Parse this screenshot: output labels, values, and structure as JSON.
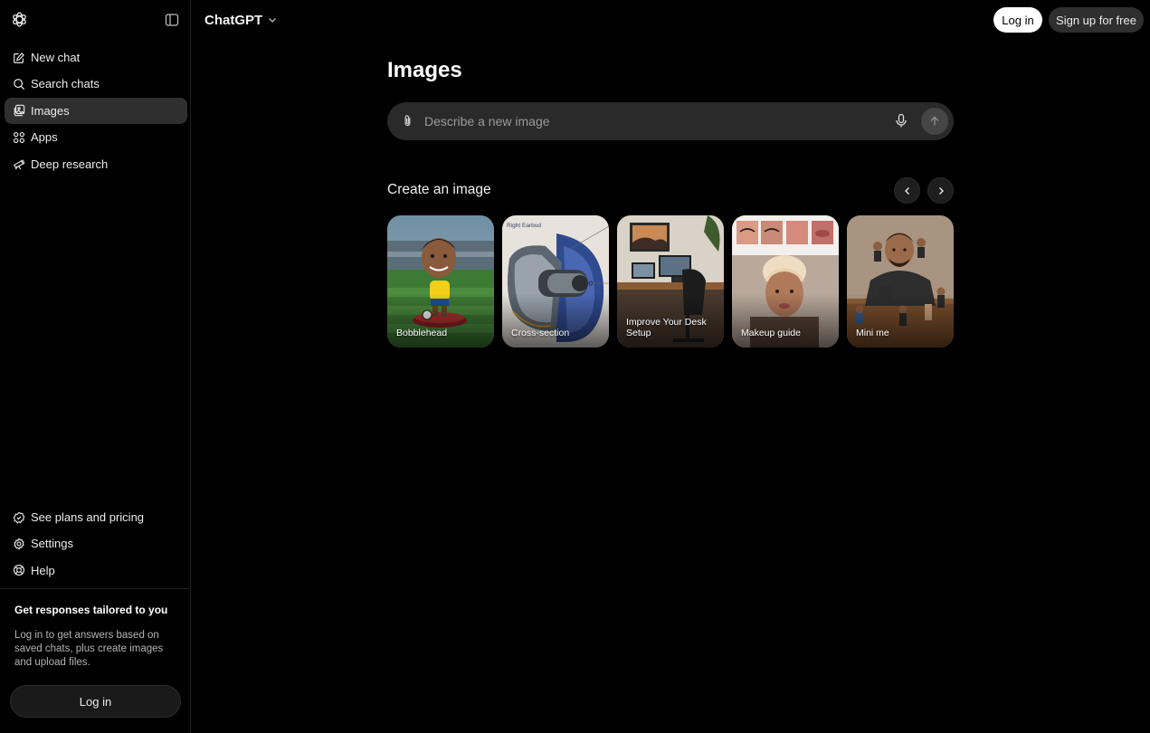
{
  "app": {
    "name": "ChatGPT"
  },
  "sidebar": {
    "items": [
      {
        "label": "New chat",
        "icon": "edit-icon"
      },
      {
        "label": "Search chats",
        "icon": "search-icon"
      },
      {
        "label": "Images",
        "icon": "images-icon",
        "active": true
      },
      {
        "label": "Apps",
        "icon": "apps-icon"
      },
      {
        "label": "Deep research",
        "icon": "telescope-icon"
      }
    ],
    "bottom_items": [
      {
        "label": "See plans and pricing",
        "icon": "plans-icon"
      },
      {
        "label": "Settings",
        "icon": "gear-icon"
      },
      {
        "label": "Help",
        "icon": "help-icon"
      }
    ],
    "promo": {
      "title": "Get responses tailored to you",
      "text": "Log in to get answers based on saved chats, plus create images and upload files."
    },
    "login_label": "Log in"
  },
  "header": {
    "model_label": "ChatGPT",
    "login_label": "Log in",
    "signup_label": "Sign up for free"
  },
  "main": {
    "title": "Images",
    "prompt": {
      "placeholder": "Describe a new image",
      "value": ""
    },
    "section_title": "Create an image",
    "cards": [
      {
        "label": "Bobblehead"
      },
      {
        "label": "Cross-section",
        "inset_text": "Right Earbud"
      },
      {
        "label": "Improve Your Desk Setup"
      },
      {
        "label": "Makeup guide"
      },
      {
        "label": "Mini me"
      }
    ]
  },
  "colors": {
    "background": "#000000",
    "sidebar_active": "#2f2f2f",
    "input_bg": "#2a2a2a",
    "primary_button": "#ffffff",
    "secondary_button": "#2f2f2f"
  }
}
